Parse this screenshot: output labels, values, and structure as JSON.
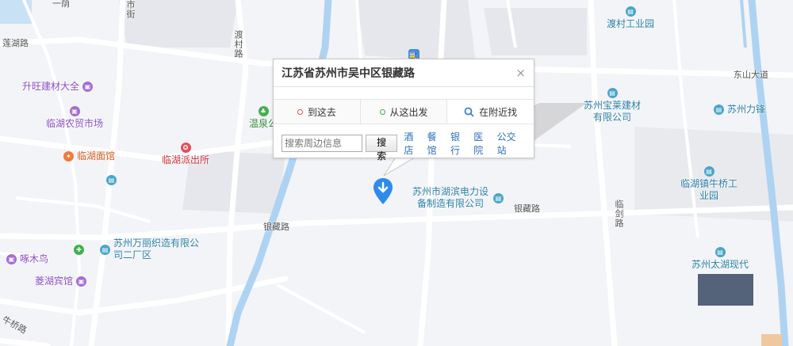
{
  "popup": {
    "title": "江苏省苏州市吴中区银藏路",
    "close_label": "×",
    "tabs": [
      {
        "label": "到这去",
        "dot_color": "#e0515a"
      },
      {
        "label": "从这出发",
        "dot_color": "#43b04a"
      },
      {
        "label": "在附近找",
        "icon": "magnifier-icon"
      }
    ],
    "search_placeholder": "搜索周边信息",
    "search_button": "搜索",
    "quick_links": [
      "酒店",
      "餐馆",
      "银行",
      "医院",
      "公交站"
    ]
  },
  "pois": {
    "shengwang": "升旺建材大全",
    "nongmao": "临湖农贸市场",
    "mianguan": "临湖面馆",
    "paichusuo": "临湖派出所",
    "wenquan": "温泉公",
    "ducun": "渡村工业园",
    "baolai": "苏州宝莱建材有限公司",
    "lifeng": "苏州力锋",
    "niuqiao": "临湖镇牛桥工业园",
    "hubin": "苏州市湖滨电力设备制造有限公司",
    "wanli": "苏州万丽织造有限公司二厂区",
    "zhuomuniao": "啄木鸟",
    "linghu": "菱湖宾馆",
    "taihu": "苏州太湖现代"
  },
  "roads": {
    "penghu": "莲湖路",
    "yicun": "一荫",
    "dongshan": "东山大道",
    "yincang_left": "银藏路",
    "yincang_right": "银藏路",
    "lingjian": "临剑路",
    "ducunlu": "渡村路",
    "niuqiao": "牛桥路",
    "jie": "市街"
  },
  "colors": {
    "pin": "#2f8bea",
    "river": "#aed3f2",
    "road": "#ffffff",
    "block": "#e8e9ee"
  }
}
